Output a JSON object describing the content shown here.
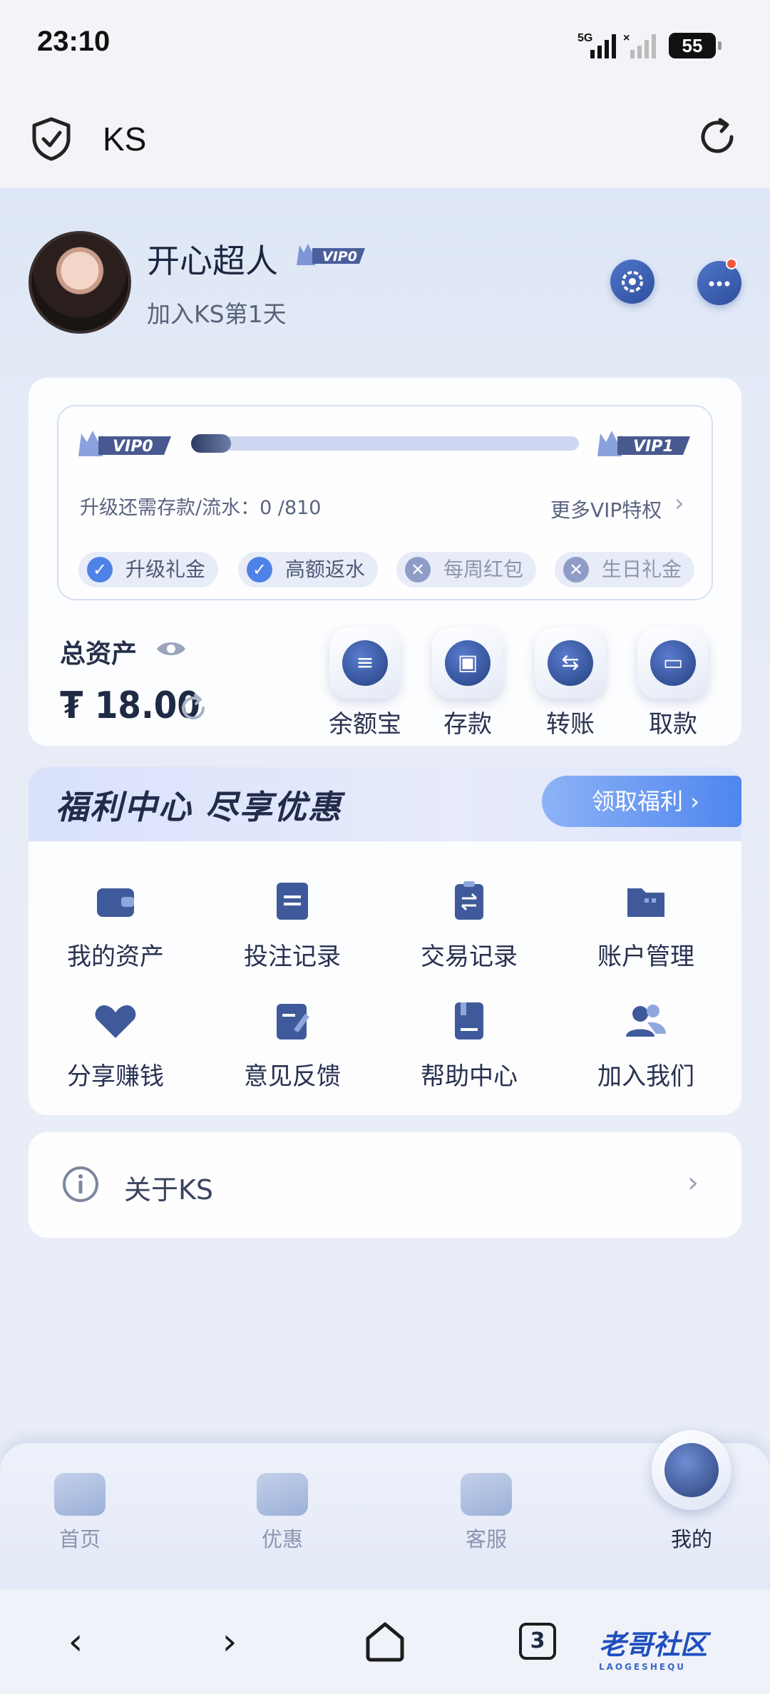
{
  "status_bar": {
    "time": "23:10",
    "network": "5G",
    "battery": "55"
  },
  "app_bar": {
    "title": "KS"
  },
  "profile": {
    "username": "开心超人",
    "vip_badge": "VIP0",
    "joined_text": "加入KS第1天"
  },
  "vip_card": {
    "current_level": "VIP0",
    "next_level": "VIP1",
    "progress": 0,
    "requirement_text": "升级还需存款/流水：0 /810",
    "more_privileges": "更多VIP特权",
    "perks": [
      {
        "label": "升级礼金",
        "enabled": true
      },
      {
        "label": "高额返水",
        "enabled": true
      },
      {
        "label": "每周红包",
        "enabled": false
      },
      {
        "label": "生日礼金",
        "enabled": false
      }
    ]
  },
  "assets": {
    "label": "总资产",
    "currency_symbol": "₮",
    "balance": "18.00",
    "actions": [
      {
        "label": "余额宝",
        "icon": "coin-stack-icon"
      },
      {
        "label": "存款",
        "icon": "deposit-wallet-icon"
      },
      {
        "label": "转账",
        "icon": "transfer-arrows-icon"
      },
      {
        "label": "取款",
        "icon": "withdraw-card-icon"
      }
    ]
  },
  "benefits": {
    "title": "福利中心  尽享优惠",
    "claim_button": "领取福利",
    "grid": [
      {
        "label": "我的资产",
        "icon": "wallet-icon"
      },
      {
        "label": "投注记录",
        "icon": "bet-record-icon"
      },
      {
        "label": "交易记录",
        "icon": "transaction-record-icon"
      },
      {
        "label": "账户管理",
        "icon": "folder-icon"
      },
      {
        "label": "分享赚钱",
        "icon": "handshake-icon"
      },
      {
        "label": "意见反馈",
        "icon": "feedback-edit-icon"
      },
      {
        "label": "帮助中心",
        "icon": "help-book-icon"
      },
      {
        "label": "加入我们",
        "icon": "people-icon"
      }
    ]
  },
  "about": {
    "label": "关于KS"
  },
  "tab_bar": {
    "tabs": [
      {
        "label": "首页",
        "icon": "home-icon",
        "active": false
      },
      {
        "label": "优惠",
        "icon": "discount-ticket-icon",
        "active": false
      },
      {
        "label": "客服",
        "icon": "headset-icon",
        "active": false
      },
      {
        "label": "我的",
        "icon": "user-icon",
        "active": true
      }
    ]
  },
  "browser_nav": {
    "open_tabs": "3"
  },
  "watermark": {
    "text": "老哥社区",
    "sub": "LAOGESHEQU"
  },
  "colors": {
    "accent": "#4f82e6",
    "dark_text": "#1f2a44",
    "background": "#e8edf7"
  }
}
